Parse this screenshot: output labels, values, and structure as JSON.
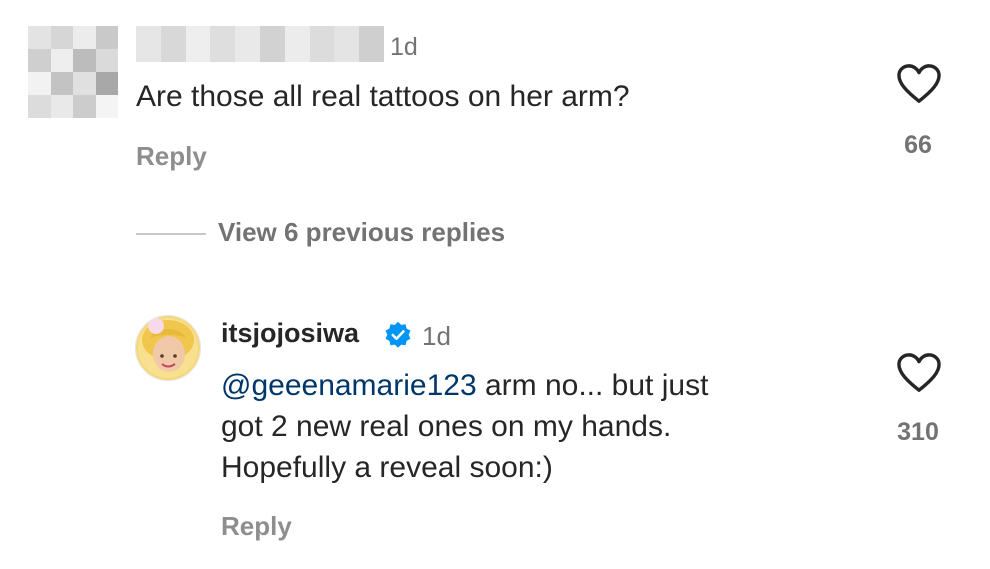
{
  "top_comment": {
    "timestamp": "1d",
    "text": "Are those all real tattoos on her arm?",
    "reply_label": "Reply",
    "like_count": "66",
    "blur_colors": [
      "#d9d9d9",
      "#bdbdbd",
      "#e8e8e8",
      "#a9a9a9",
      "#cfcfcf",
      "#f0f0f0",
      "#b5b5b5",
      "#dcdcdc"
    ]
  },
  "view_replies": {
    "label": "View 6 previous replies"
  },
  "reply_comment": {
    "username": "itsjojosiwa",
    "verified": true,
    "timestamp": "1d",
    "mention": "@geeenamarie123",
    "text_line1": " arm no... but just",
    "text_line2": "got 2 new real ones on my hands.",
    "text_line3": "Hopefully a reveal soon:)",
    "reply_label": "Reply",
    "like_count": "310"
  },
  "colors": {
    "text": "#262626",
    "secondary": "#737373",
    "mention": "#00376b",
    "verified": "#0095f6",
    "avatar_ring": "#f7c948"
  },
  "icons": {
    "like": "heart-outline-icon",
    "verified": "verified-badge-icon"
  }
}
